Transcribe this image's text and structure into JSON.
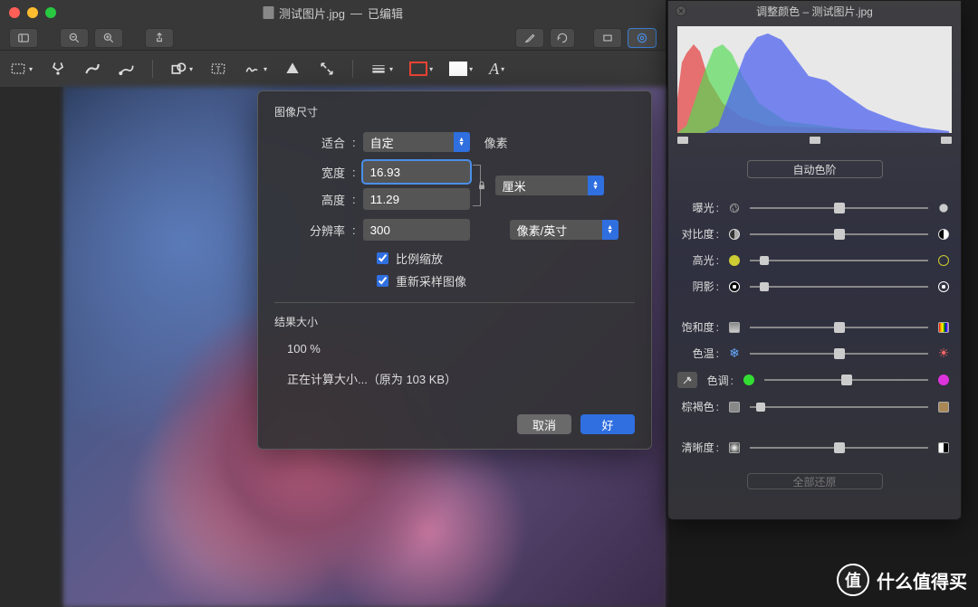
{
  "window": {
    "filename": "测试图片.jpg",
    "status": "已编辑",
    "title_sep": " — "
  },
  "dialog": {
    "section_image_size": "图像尺寸",
    "fit_label": "适合",
    "fit_value": "自定",
    "fit_unit": "像素",
    "width_label": "宽度",
    "width_value": "16.93",
    "height_label": "高度",
    "height_value": "11.29",
    "wh_unit": "厘米",
    "res_label": "分辨率",
    "res_value": "300",
    "res_unit": "像素/英寸",
    "chk_scale": "比例缩放",
    "chk_resample": "重新采样图像",
    "section_result": "结果大小",
    "result_pct": "100 %",
    "result_msg": "正在计算大小...（原为 103 KB）",
    "btn_cancel": "取消",
    "btn_ok": "好"
  },
  "adjust": {
    "panel_title": "调整颜色 – 测试图片.jpg",
    "auto_levels": "自动色阶",
    "reset_all": "全部还原",
    "sliders": {
      "exposure": {
        "label": "曝光",
        "pos": 50
      },
      "contrast": {
        "label": "对比度",
        "pos": 50
      },
      "highlights": {
        "label": "高光",
        "pos": 8
      },
      "shadows": {
        "label": "阴影",
        "pos": 8
      },
      "saturation": {
        "label": "饱和度",
        "pos": 50
      },
      "temperature": {
        "label": "色温",
        "pos": 50
      },
      "tint": {
        "label": "色调",
        "pos": 50
      },
      "sepia": {
        "label": "棕褐色",
        "pos": 6
      },
      "sharpness": {
        "label": "清晰度",
        "pos": 50
      }
    }
  },
  "watermark": {
    "badge": "值",
    "text": "什么值得买"
  }
}
